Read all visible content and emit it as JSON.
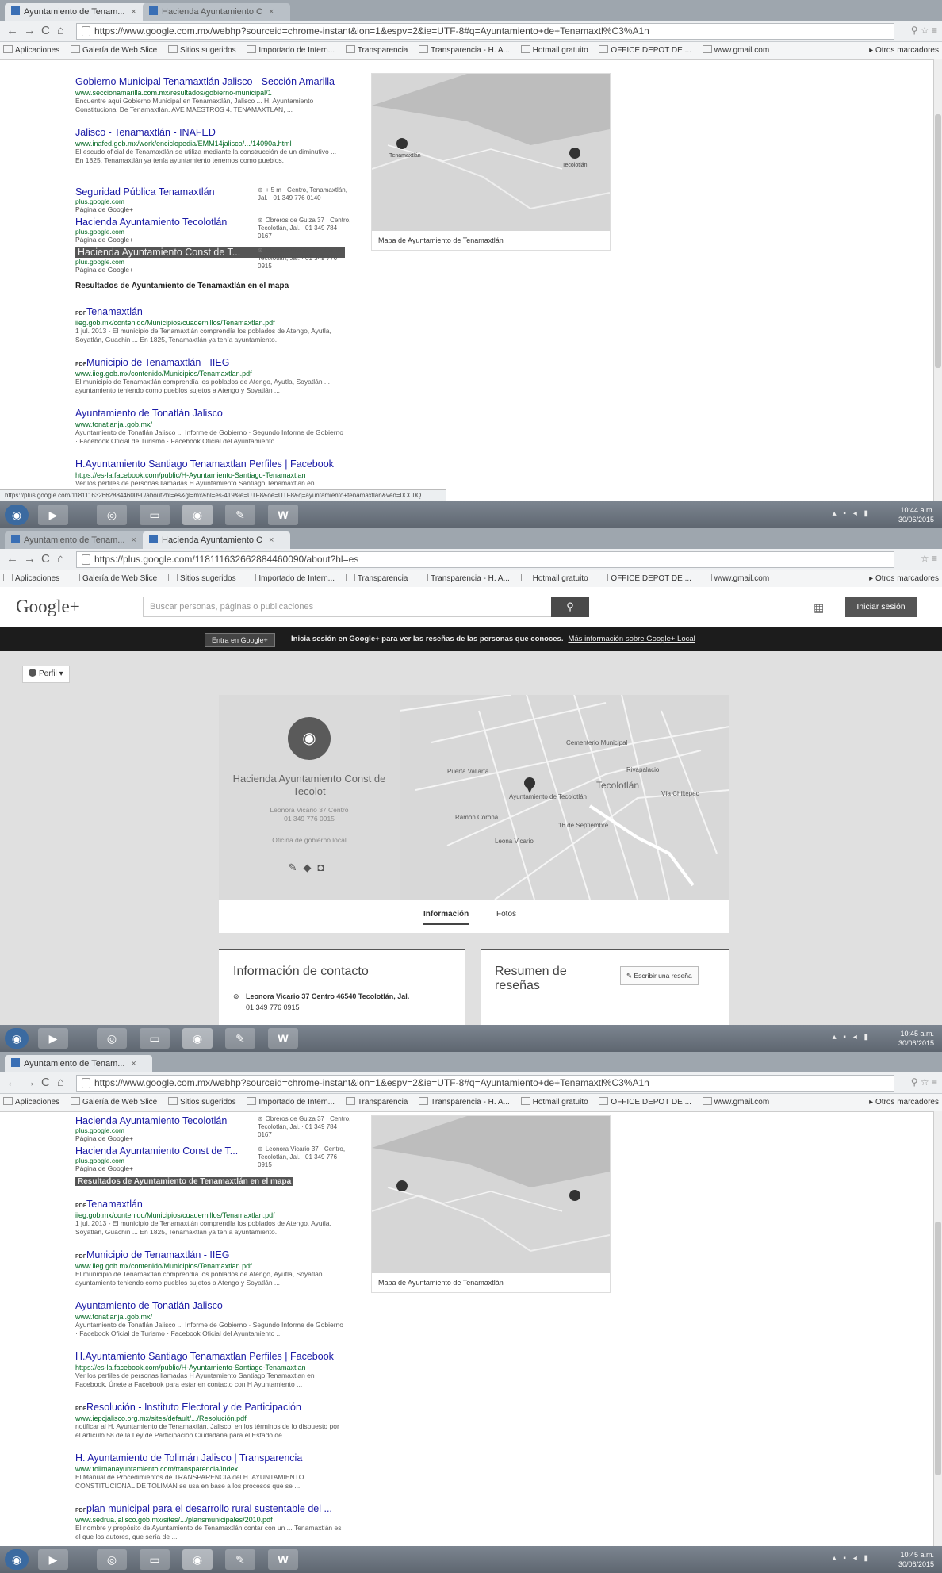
{
  "common": {
    "bookmarks": [
      "Aplicaciones",
      "Galería de Web Slice",
      "Sitios sugeridos",
      "Importado de Intern...",
      "Transparencia",
      "Transparencia - H. A...",
      "Hotmail gratuito",
      "OFFICE DEPOT DE ...",
      "www.gmail.com"
    ],
    "bookmarks_other": "Otros marcadores",
    "clock": {
      "time": "10:44 a.m.",
      "date": "30/06/2015"
    },
    "clock2": {
      "time": "10:45 a.m.",
      "date": "30/06/2015"
    },
    "taskbar_w": "W"
  },
  "shot1": {
    "tab_active": "Ayuntamiento de Tenam...",
    "tab_inactive": "Hacienda Ayuntamiento C",
    "url": "https://www.google.com.mx/webhp?sourceid=chrome-instant&ion=1&espv=2&ie=UTF-8#q=Ayuntamiento+de+Tenamaxtl%C3%A1n",
    "results_top": [
      {
        "title": "Gobierno Municipal Tenamaxtlán Jalisco - Sección Amarilla",
        "url": "www.seccionamarilla.com.mx/resultados/gobierno-municipal/1",
        "snip": "Encuentre aquí Gobierno Municipal en Tenamaxtlán, Jalisco ... H. Ayuntamiento Constitucional De Tenamaxtlán. AVE MAESTROS 4. TENAMAXTLAN, ..."
      },
      {
        "title": "Jalisco - Tenamaxtlán - INAFED",
        "url": "www.inafed.gob.mx/work/enciclopedia/EMM14jalisco/.../14090a.html",
        "snip": "El escudo oficial de Tenamaxtlán se utiliza mediante la construcción de un diminutivo ... En 1825, Tenamaxtlán ya tenía ayuntamiento tenemos como pueblos."
      }
    ],
    "local": [
      {
        "title": "Seguridad Pública Tenamaxtlán",
        "url": "plus.google.com",
        "page": "Página de Google+",
        "addr": "+ 5 m · Centro, Tenamaxtlán, Jal. · 01 349 776 0140"
      },
      {
        "title": "Hacienda Ayuntamiento Tecolotlán",
        "url": "plus.google.com",
        "page": "Página de Google+",
        "addr": "Obreros de Guiza 37 · Centro, Tecolotlán, Jal. · 01 349 784 0167"
      },
      {
        "title": "Hacienda Ayuntamiento Const de T...",
        "url": "plus.google.com",
        "page": "Página de Google+",
        "addr": "Leonora Vicario 37 · Centro, Tecolotlán, Jal. · 01 349 776 0915"
      }
    ],
    "local_footer": "Resultados de Ayuntamiento de Tenamaxtlán en el mapa",
    "results_bottom": [
      {
        "title": "Tenamaxtlán",
        "url": "iieg.gob.mx/contenido/Municipios/cuadernillos/Tenamaxtlan.pdf",
        "snip": "1 jul. 2013 - El municipio de Tenamaxtlán comprendía los poblados de Atengo, Ayutla, Soyatlán, Guachin ... En 1825, Tenamaxtlán ya tenía ayuntamiento."
      },
      {
        "title": "Municipio de Tenamaxtlán - IIEG",
        "url": "www.iieg.gob.mx/contenido/Municipios/Tenamaxtlan.pdf",
        "snip": "El municipio de Tenamaxtlán comprendía los poblados de Atengo, Ayutla, Soyatlán ... ayuntamiento teniendo como pueblos sujetos a Atengo y Soyatlán ..."
      },
      {
        "title": "Ayuntamiento de Tonatlán Jalisco",
        "url": "www.tonatlanjal.gob.mx/",
        "snip": "Ayuntamiento de Tonatlán Jalisco ... Informe de Gobierno · Segundo Informe de Gobierno · Facebook Oficial de Turismo · Facebook Oficial del Ayuntamiento ..."
      },
      {
        "title": "H.Ayuntamiento Santiago Tenamaxtlan Perfiles | Facebook",
        "url": "https://es-la.facebook.com/public/H-Ayuntamiento-Santiago-Tenamaxtlan",
        "snip": "Ver los perfiles de personas llamadas H Ayuntamiento Santiago Tenamaxtlan en Facebook. Únete a Facebook para estar en contacto con H Ayuntamiento ..."
      }
    ],
    "map_caption": "Mapa de Ayuntamiento de Tenamaxtlán",
    "map_places": [
      "Tenamaxtlán",
      "Tecolotlán"
    ],
    "status_url": "https://plus.google.com/118111632662884460090/about?hl=es&gl=mx&hl=es-419&ie=UTF8&oe=UTF8&q=ayuntamiento+tenamaxtlan&ved=0CC0Q"
  },
  "shot2": {
    "tab_inactive": "Ayuntamiento de Tenam...",
    "tab_active": "Hacienda Ayuntamiento C",
    "url": "https://plus.google.com/118111632662884460090/about?hl=es",
    "gp_logo": "Google+",
    "search_placeholder": "Buscar personas, páginas o publicaciones",
    "signin": "Iniciar sesión",
    "entra": "Entra en Google+",
    "banner_msg": "Inicia sesión en Google+ para ver las reseñas de las personas que conoces.",
    "banner_more": "Más información sobre Google+ Local",
    "perfil": "Perfil",
    "place_name": "Hacienda Ayuntamiento Const de Tecolot",
    "place_addr": "Leonora Vicario 37 Centro",
    "place_phone": "01 349 776 0915",
    "place_category": "Oficina de gobierno local",
    "map_labels": [
      "Tecolotlán",
      "Cementerio Municipal",
      "Ayuntamiento de Tecolotlán",
      "Puerta Vallarta",
      "Ramón Corona",
      "Leona Vicario",
      "16 de Septiembre",
      "Rivapalacio",
      "Vía Chiltepec"
    ],
    "tab_info": "Información",
    "tab_photos": "Fotos",
    "contact_title": "Información de contacto",
    "contact_addr": "Leonora Vicario 37 Centro 46540 Tecolotlán, Jal.",
    "contact_phone": "01 349 776 0915",
    "reviews_title": "Resumen de reseñas",
    "write_review": "Escribir una reseña"
  },
  "shot3": {
    "tab_active": "Ayuntamiento de Tenam...",
    "url": "https://www.google.com.mx/webhp?sourceid=chrome-instant&ion=1&espv=2&ie=UTF-8#q=Ayuntamiento+de+Tenamaxtl%C3%A1n",
    "local": [
      {
        "title": "Hacienda Ayuntamiento Tecolotlán",
        "url": "plus.google.com",
        "page": "Página de Google+",
        "addr": "Obreros de Guiza 37 · Centro, Tecolotlán, Jal. · 01 349 784 0167"
      },
      {
        "title": "Hacienda Ayuntamiento Const de T...",
        "url": "plus.google.com",
        "page": "Página de Google+",
        "addr": "Leonora Vicario 37 · Centro, Tecolotlán, Jal. · 01 349 776 0915"
      }
    ],
    "local_footer": "Resultados de Ayuntamiento de Tenamaxtlán en el mapa",
    "results": [
      {
        "title": "Tenamaxtlán",
        "url": "iieg.gob.mx/contenido/Municipios/cuadernillos/Tenamaxtlan.pdf",
        "snip": "1 jul. 2013 - El municipio de Tenamaxtlán comprendía los poblados de Atengo, Ayutla, Soyatlán, Guachin ... En 1825, Tenamaxtlán ya tenía ayuntamiento."
      },
      {
        "title": "Municipio de Tenamaxtlán - IIEG",
        "url": "www.iieg.gob.mx/contenido/Municipios/Tenamaxtlan.pdf",
        "snip": "El municipio de Tenamaxtlán comprendía los poblados de Atengo, Ayutla, Soyatlán ... ayuntamiento teniendo como pueblos sujetos a Atengo y Soyatlán ..."
      },
      {
        "title": "Ayuntamiento de Tonatlán Jalisco",
        "url": "www.tonatlanjal.gob.mx/",
        "snip": "Ayuntamiento de Tonatlán Jalisco ... Informe de Gobierno · Segundo Informe de Gobierno · Facebook Oficial de Turismo · Facebook Oficial del Ayuntamiento ..."
      },
      {
        "title": "H.Ayuntamiento Santiago Tenamaxtlan Perfiles | Facebook",
        "url": "https://es-la.facebook.com/public/H-Ayuntamiento-Santiago-Tenamaxtlan",
        "snip": "Ver los perfiles de personas llamadas H Ayuntamiento Santiago Tenamaxtlan en Facebook. Únete a Facebook para estar en contacto con H Ayuntamiento ..."
      },
      {
        "title": "Resolución - Instituto Electoral y de Participación",
        "url": "www.iepcjalisco.org.mx/sites/default/.../Resolución.pdf",
        "snip": "notificar al H. Ayuntamiento de Tenamaxtlán, Jalisco, en los términos de lo dispuesto por el artículo 58 de la Ley de Participación Ciudadana para el Estado de ..."
      },
      {
        "title": "H. Ayuntamiento de Tolimán Jalisco | Transparencia",
        "url": "www.tolimanayuntamiento.com/transparencia/index",
        "snip": "El Manual de Procedimientos de TRANSPARENCIA del H. AYUNTAMIENTO CONSTITUCIONAL DE TOLIMAN se usa en base a los procesos que se ..."
      },
      {
        "title": "plan municipal para el desarrollo rural sustentable del ...",
        "url": "www.sedrua.jalisco.gob.mx/sites/.../plansmunicipales/2010.pdf",
        "snip": "El nombre y propósito de Ayuntamiento de Tenamaxtlán contar con un ... Tenamaxtlán es el que los autores, que sería de ..."
      }
    ],
    "map_caption": "Mapa de Ayuntamiento de Tenamaxtlán"
  }
}
